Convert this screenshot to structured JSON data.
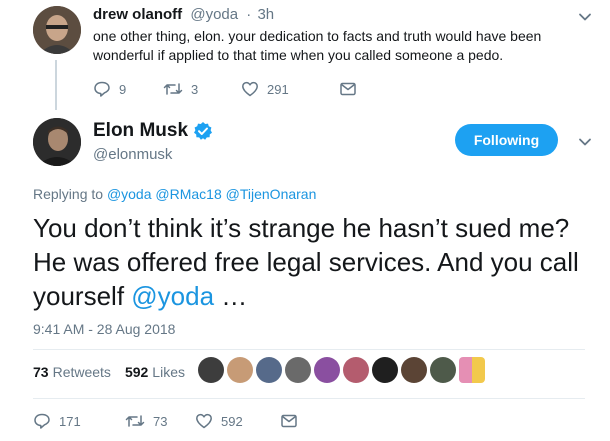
{
  "reply_tweet": {
    "name": "drew olanoff",
    "handle": "@yoda",
    "time": "3h",
    "text": "one other thing, elon. your dedication to facts and truth would have been wonderful if applied to that time when you called someone a pedo.",
    "reply_count": "9",
    "retweet_count": "3",
    "like_count": "291",
    "icons": [
      "reply-icon",
      "retweet-icon",
      "heart-icon",
      "mail-icon",
      "chevron-down-icon"
    ]
  },
  "main_tweet": {
    "name": "Elon Musk",
    "handle": "@elonmusk",
    "verified": true,
    "follow_label": "Following",
    "replying_prefix": "Replying to",
    "replying_to": [
      "@yoda",
      "@RMac18",
      "@TijenOnaran"
    ],
    "text_part1": "You don’t think it’s strange he hasn’t sued me? He was offered free legal services. And you call yourself ",
    "text_mention": "@yoda",
    "text_part2": " …",
    "timestamp": "9:41 AM - 28 Aug 2018",
    "retweets_count": "73",
    "retweets_label": "Retweets",
    "likes_count": "592",
    "likes_label": "Likes",
    "reply_count": "171",
    "retweet_count": "73",
    "like_count": "592",
    "liker_avatars": 10
  },
  "colors": {
    "accent": "#1da1f2",
    "link": "#1b95e0",
    "muted": "#657786",
    "text": "#14171a",
    "border": "#e6ecf0"
  }
}
